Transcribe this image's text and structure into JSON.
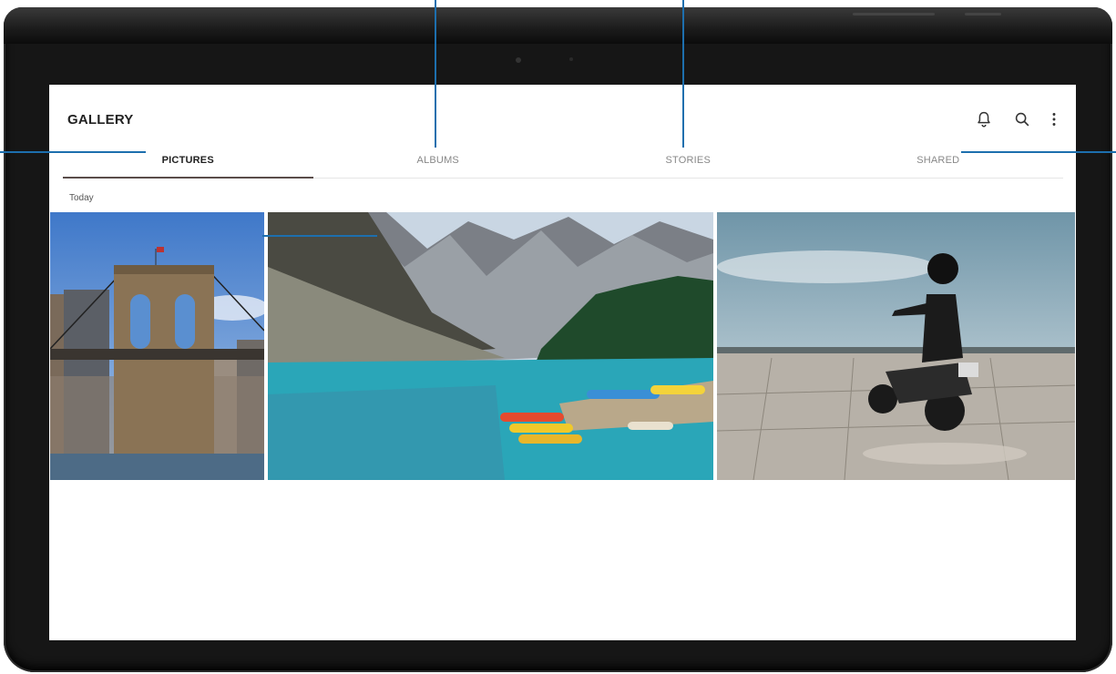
{
  "app": {
    "title": "GALLERY"
  },
  "header_icons": [
    "bell-icon",
    "search-icon",
    "more-vert-icon"
  ],
  "tabs": [
    {
      "label": "PICTURES",
      "active": true
    },
    {
      "label": "ALBUMS",
      "active": false
    },
    {
      "label": "STORIES",
      "active": false
    },
    {
      "label": "SHARED",
      "active": false
    }
  ],
  "section": {
    "label": "Today"
  },
  "photos": [
    {
      "subject": "bridge"
    },
    {
      "subject": "mountain-lake"
    },
    {
      "subject": "motorcycle"
    }
  ],
  "colors": {
    "accent": "#1d6fae",
    "tab_indicator": "#5a4d4a",
    "frame": "#161616"
  }
}
